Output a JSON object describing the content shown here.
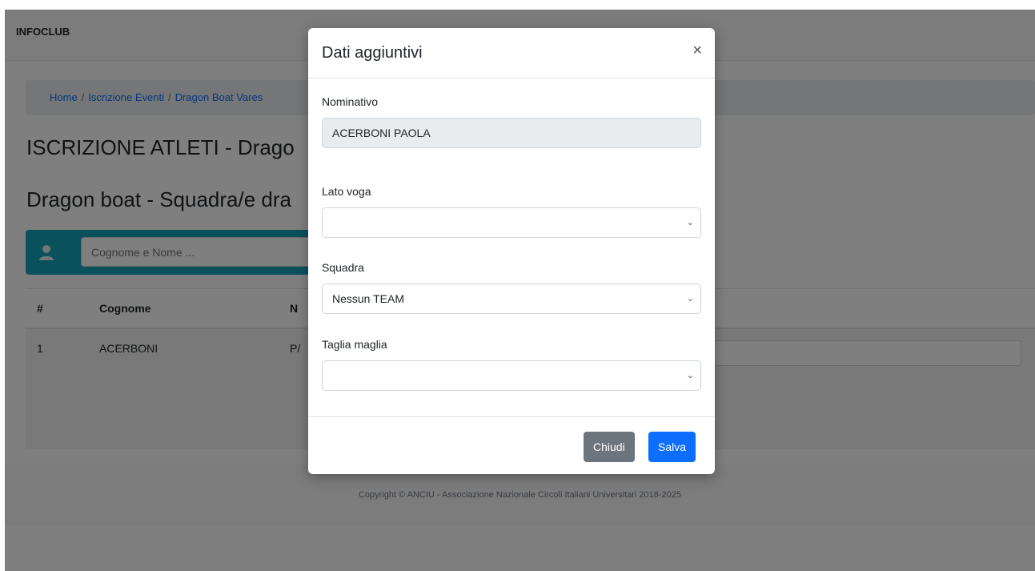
{
  "navbar": {
    "brand": "INFOCLUB"
  },
  "breadcrumb": {
    "items": [
      "Home",
      "Iscrizione Eventi",
      "Dragon Boat Vares"
    ]
  },
  "page": {
    "title": "ISCRIZIONE ATLETI - Drago",
    "subtitle": "Dragon boat - Squadra/e dra"
  },
  "search": {
    "placeholder": "Cognome e Nome ..."
  },
  "table": {
    "headers": [
      "#",
      "Cognome",
      "N"
    ],
    "rows": [
      {
        "num": "1",
        "cognome": "ACERBONI",
        "nome": "P/"
      }
    ]
  },
  "footer": {
    "copyright": "Copyright © ANCIU - Associazione Nazionale Circoli Italiani Universitari 2018-2025"
  },
  "modal": {
    "title": "Dati aggiuntivi",
    "close_glyph": "×",
    "nominativo_label": "Nominativo",
    "nominativo_value": "ACERBONI PAOLA",
    "lato_label": "Lato voga",
    "lato_value": "",
    "squadra_label": "Squadra",
    "squadra_value": "Nessun TEAM",
    "taglia_label": "Taglia maglia",
    "taglia_value": "",
    "chiudi_label": "Chiudi",
    "salva_label": "Salva"
  },
  "colors": {
    "accent": "#0d6efd",
    "search_bar": "#17a2b8",
    "secondary": "#6c757d"
  },
  "icons": {
    "search": "user-icon",
    "close": "close-icon",
    "select": "chevron-down-icon"
  }
}
